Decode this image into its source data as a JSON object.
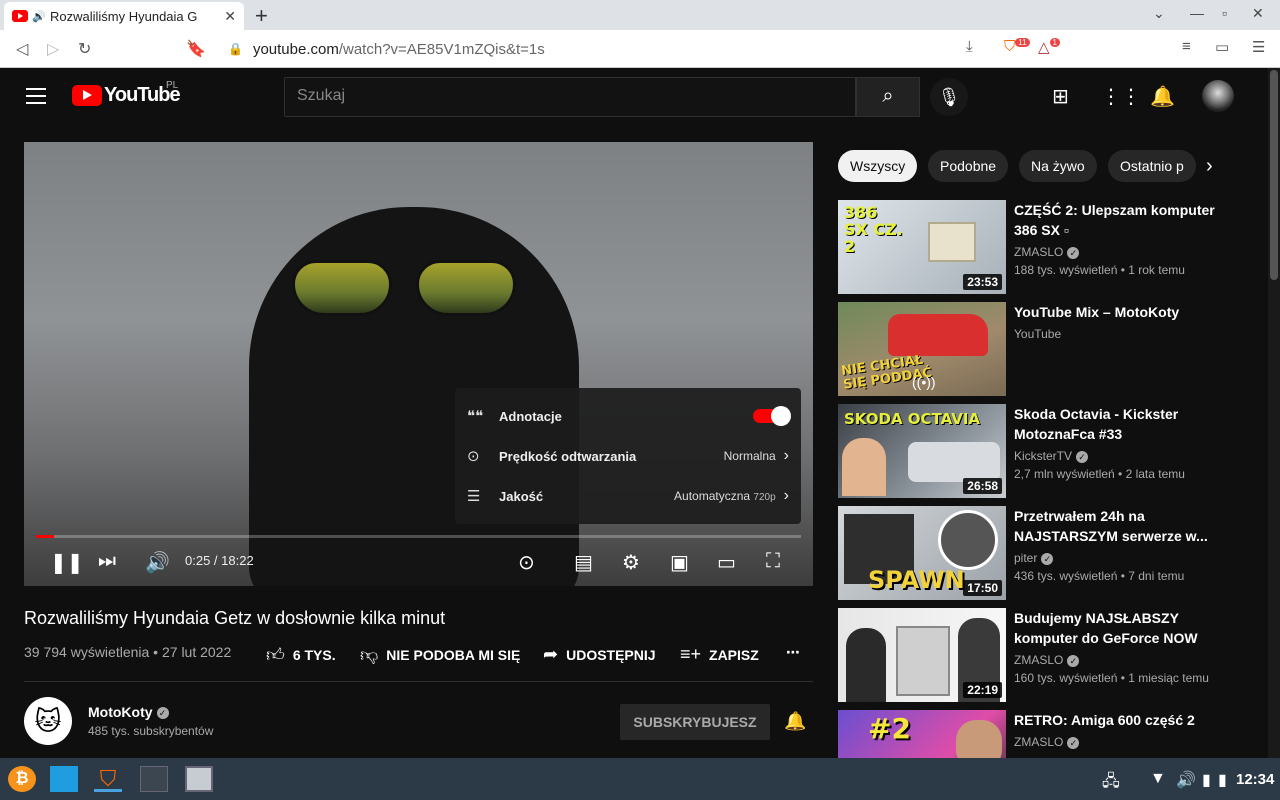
{
  "browser": {
    "tab_title": "Rozwaliliśmy Hyundaia G",
    "url_host": "youtube.com",
    "url_path": "/watch?v=AE85V1mZQis&t=1s",
    "ext_badge_1": "11",
    "ext_badge_2": "1"
  },
  "header": {
    "logo_text": "YouTube",
    "country": "PL",
    "search_placeholder": "Szukaj"
  },
  "player": {
    "current_time": "0:25 / 18:22",
    "progress_fraction": 0.023,
    "settings": {
      "annotations_label": "Adnotacje",
      "annotations_on": true,
      "speed_label": "Prędkość odtwarzania",
      "speed_value": "Normalna",
      "quality_label": "Jakość",
      "quality_value": "Automatyczna",
      "quality_sub": "720p"
    }
  },
  "video": {
    "title": "Rozwaliliśmy Hyundaia Getz w dosłownie kilka minut",
    "meta": "39 794 wyświetlenia • 27 lut 2022",
    "likes": "6 TYS.",
    "dislike": "NIE PODOBA MI SIĘ",
    "share": "UDOSTĘPNIJ",
    "save": "ZAPISZ"
  },
  "channel": {
    "name": "MotoKoty",
    "subs": "485 tys. subskrybentów",
    "subscribe_label": "SUBSKRYBUJESZ"
  },
  "chips": [
    "Wszyscy",
    "Podobne",
    "Na żywo",
    "Ostatnio p"
  ],
  "recommendations": [
    {
      "title": "CZĘŚĆ 2: Ulepszam komputer 386 SX ▫",
      "channel": "ZMASLO",
      "verified": true,
      "stats": "188 tys. wyświetleń • 1 rok temu",
      "duration": "23:53",
      "thumb_text": "386 SX CZ. 2"
    },
    {
      "title": "YouTube Mix – MotoKoty",
      "channel": "YouTube",
      "verified": false,
      "stats": "",
      "duration": "",
      "thumb_text": "NIE CHCIAŁ SIĘ PODDAĆ"
    },
    {
      "title": "Skoda Octavia - Kickster MotoznaFca #33",
      "channel": "KicksterTV",
      "verified": true,
      "stats": "2,7 mln wyświetleń • 2 lata temu",
      "duration": "26:58",
      "thumb_text": "SKODA OCTAVIA"
    },
    {
      "title": "Przetrwałem 24h na NAJSTARSZYM serwerze w...",
      "channel": "piter",
      "verified": true,
      "stats": "436 tys. wyświetleń • 7 dni temu",
      "duration": "17:50",
      "thumb_text": "SPAWN"
    },
    {
      "title": "Budujemy NAJSŁABSZY komputer do GeForce NOW",
      "channel": "ZMASLO",
      "verified": true,
      "stats": "160 tys. wyświetleń • 1 miesiąc temu",
      "duration": "22:19",
      "thumb_text": ""
    },
    {
      "title": "RETRO: Amiga 600 część 2",
      "channel": "ZMASLO",
      "verified": true,
      "stats": "",
      "duration": "",
      "thumb_text": "#2"
    }
  ],
  "taskbar": {
    "clock": "12:34"
  },
  "colors": {
    "yt_red": "#ff0000",
    "background": "#0f0f0f",
    "taskbar": "#2b3a46"
  }
}
